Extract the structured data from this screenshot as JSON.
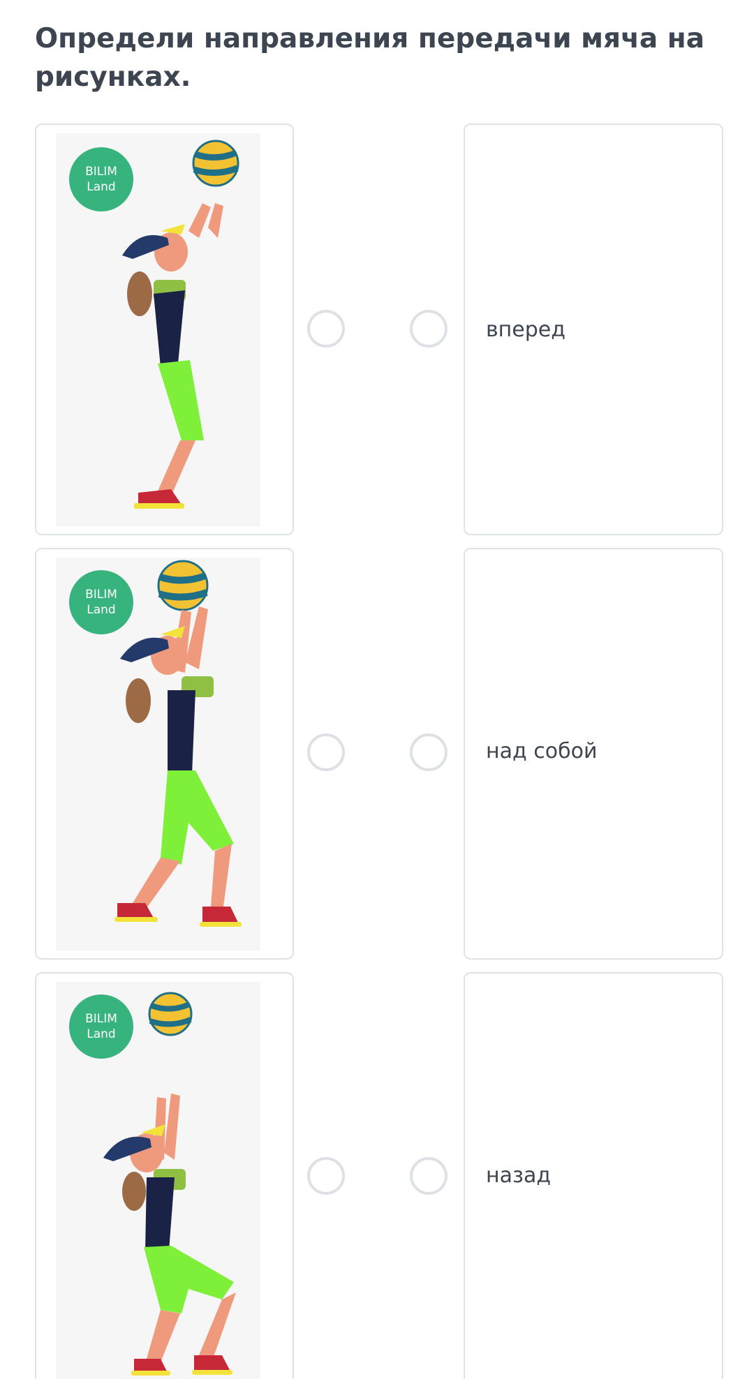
{
  "question": {
    "title": "Определи направления передачи мяча на рисунках."
  },
  "images": [
    {
      "logo_text_1": "BILIM",
      "logo_text_2": "Land"
    },
    {
      "logo_text_1": "BILIM",
      "logo_text_2": "Land"
    },
    {
      "logo_text_1": "BILIM",
      "logo_text_2": "Land"
    }
  ],
  "answers": [
    {
      "label": "вперед"
    },
    {
      "label": "над собой"
    },
    {
      "label": "назад"
    }
  ],
  "colors": {
    "heading": "#3d4550",
    "card_border": "#dfe3e8",
    "radio_border": "#dde1e6",
    "logo_green": "#37b37e",
    "shorts_green": "#7ef03a",
    "top_navy": "#1a2245"
  }
}
